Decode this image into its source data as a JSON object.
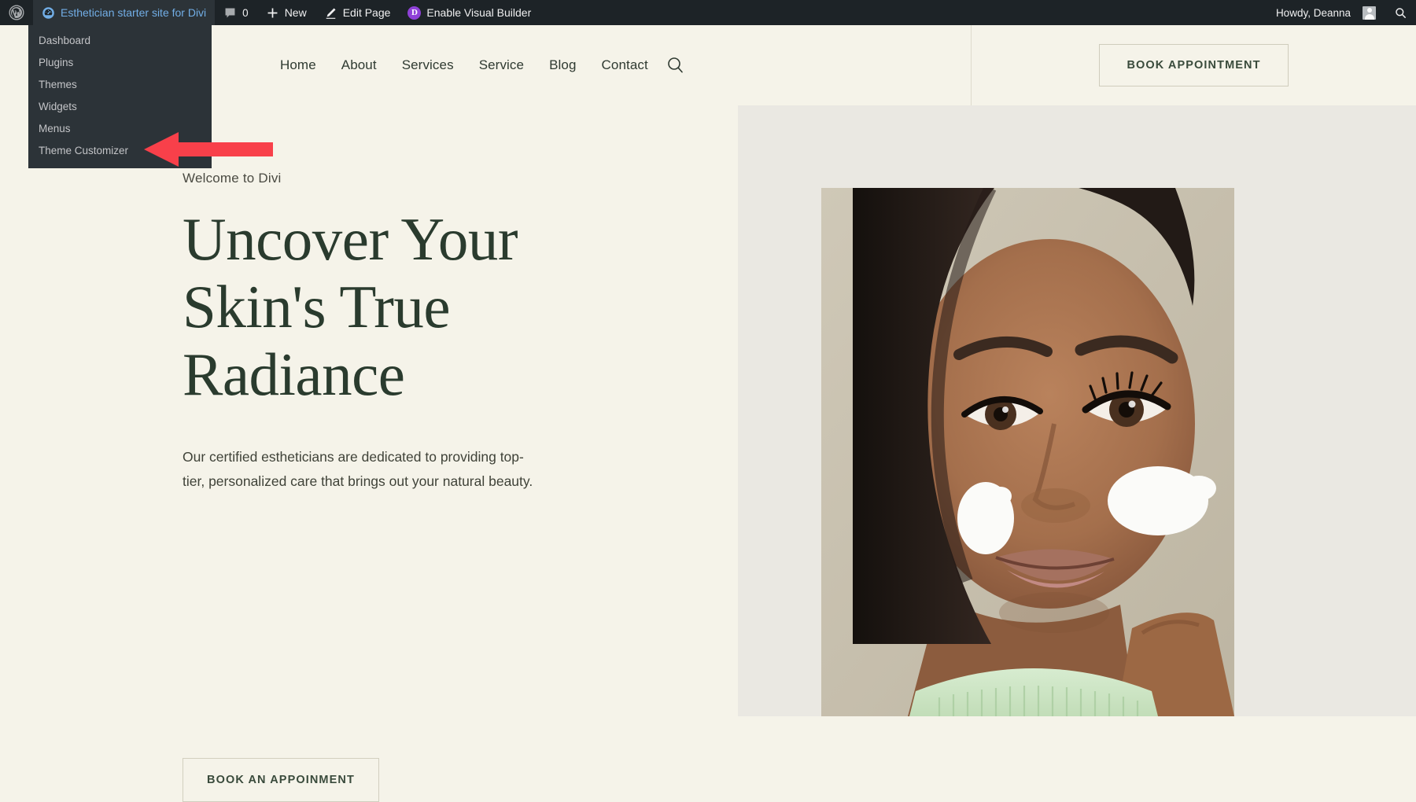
{
  "adminbar": {
    "wp_logo_name": "wordpress-logo-icon",
    "site_name": "Esthetician starter site for Divi",
    "comment_count": "0",
    "new_label": "New",
    "edit_page_label": "Edit Page",
    "visual_builder_label": "Enable Visual Builder",
    "divi_badge": "D",
    "howdy": "Howdy, Deanna",
    "dropdown": [
      {
        "label": "Dashboard"
      },
      {
        "label": "Plugins"
      },
      {
        "label": "Themes"
      },
      {
        "label": "Widgets"
      },
      {
        "label": "Menus"
      },
      {
        "label": "Theme Customizer"
      }
    ]
  },
  "site_header": {
    "nav": [
      {
        "label": "Home"
      },
      {
        "label": "About"
      },
      {
        "label": "Services"
      },
      {
        "label": "Service"
      },
      {
        "label": "Blog"
      },
      {
        "label": "Contact"
      }
    ],
    "cta_label": "Book Appointment"
  },
  "hero": {
    "eyebrow": "Welcome to Divi",
    "title_line1": "Uncover Your",
    "title_line2": "Skin's True",
    "title_line3": "Radiance",
    "paragraph": "Our certified estheticians are dedicated to providing top-tier, personalized care that brings out your natural beauty.",
    "cta_label": "Book an Appoinment",
    "image_alt": "woman-with-face-cream-photo"
  },
  "annotation": {
    "arrow_color": "#f8404a",
    "points_at": "Theme Customizer"
  },
  "colors": {
    "adminbar_bg": "#1d2327",
    "dropdown_bg": "#2c3338",
    "site_bg_left": "#f5f3e9",
    "site_bg_right": "#eae8e2",
    "heading": "#2a3b2e",
    "link_blue": "#72aee6",
    "divi_purple": "#8f41d8"
  }
}
